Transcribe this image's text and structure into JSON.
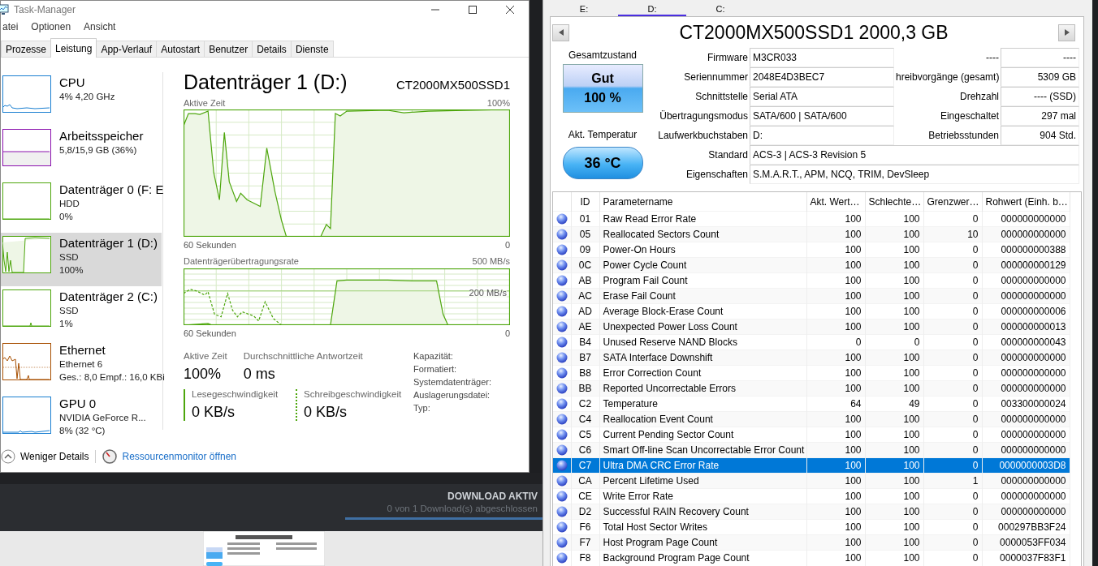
{
  "task_manager": {
    "title": "Task-Manager",
    "menu": [
      "atei",
      "Optionen",
      "Ansicht"
    ],
    "tabs": [
      {
        "label": "Prozesse",
        "selected": false
      },
      {
        "label": "Leistung",
        "selected": true
      },
      {
        "label": "App-Verlauf",
        "selected": false
      },
      {
        "label": "Autostart",
        "selected": false
      },
      {
        "label": "Benutzer",
        "selected": false
      },
      {
        "label": "Details",
        "selected": false
      },
      {
        "label": "Dienste",
        "selected": false
      }
    ],
    "devices": [
      {
        "kind": "cpu",
        "name": "CPU",
        "lines": [
          "4%  4,20 GHz"
        ],
        "selected": false
      },
      {
        "kind": "memory",
        "name": "Arbeitsspeicher",
        "lines": [
          "5,8/15,9 GB (36%)"
        ],
        "selected": false
      },
      {
        "kind": "disk",
        "name": "Datenträger 0 (F: E",
        "lines": [
          "HDD",
          "0%"
        ],
        "selected": false
      },
      {
        "kind": "disk",
        "name": "Datenträger 1 (D:)",
        "lines": [
          "SSD",
          "100%"
        ],
        "selected": true
      },
      {
        "kind": "disk",
        "name": "Datenträger 2 (C:)",
        "lines": [
          "SSD",
          "1%"
        ],
        "selected": false
      },
      {
        "kind": "ethernet",
        "name": "Ethernet",
        "lines": [
          "Ethernet 6",
          "Ges.: 8,0  Empf.: 16,0 KBi"
        ],
        "selected": false
      },
      {
        "kind": "gpu",
        "name": "GPU 0",
        "lines": [
          "NVIDIA GeForce R...",
          "8%  (32 °C)"
        ],
        "selected": false
      }
    ],
    "detail": {
      "title": "Datenträger 1 (D:)",
      "model": "CT2000MX500SSD1",
      "graphs": [
        {
          "kind": "active",
          "label": "Aktive Zeit",
          "max": "100%",
          "time": "60 Sekunden",
          "min": "0"
        },
        {
          "kind": "transfer",
          "label": "Datenträgerübertragungsrate",
          "max": "500 MB/s",
          "marker": "200 MB/s",
          "time": "60 Sekunden",
          "min": "0"
        }
      ],
      "stats": [
        {
          "label": "Aktive Zeit",
          "value": "100%"
        },
        {
          "label": "Durchschnittliche Antwortzeit",
          "value": "0 ms"
        }
      ],
      "speeds": [
        {
          "kind": "read",
          "label": "Lesegeschwindigkeit",
          "value": "0 KB/s"
        },
        {
          "kind": "write",
          "label": "Schreibgeschwindigkeit",
          "value": "0 KB/s"
        }
      ],
      "properties": [
        "Kapazität:",
        "Formatiert:",
        "Systemdatenträger:",
        "Auslagerungsdatei:",
        "Typ:"
      ]
    },
    "footer": {
      "toggle": "Weniger Details",
      "link": "Ressourcenmonitor öffnen"
    }
  },
  "download": {
    "title": "DOWNLOAD AKTIV",
    "status": "0 von 1 Download(s) abgeschlossen",
    "level": 1
  },
  "disk_info": {
    "drives": [
      {
        "label": "E:",
        "selected": false
      },
      {
        "label": "D:",
        "selected": true
      },
      {
        "label": "C:",
        "selected": false
      }
    ],
    "title": "CT2000MX500SSD1 2000,3 GB",
    "health": {
      "label": "Gesamtzustand",
      "status": "Gut",
      "percent": "100 %"
    },
    "temperature": {
      "label": "Akt. Temperatur",
      "value": "36 °C"
    },
    "fields": [
      {
        "label": "Firmware",
        "value": "M3CR033",
        "right_label": "----",
        "right_value": "----"
      },
      {
        "label": "Seriennummer",
        "value": "2048E4D3BEC7",
        "right_label": "hreibvorgänge (gesamt)",
        "right_value": "5309 GB"
      },
      {
        "label": "Schnittstelle",
        "value": "Serial ATA",
        "right_label": "Drehzahl",
        "right_value": "---- (SSD)"
      },
      {
        "label": "Übertragungsmodus",
        "value": "SATA/600 | SATA/600",
        "right_label": "Eingeschaltet",
        "right_value": "297 mal"
      },
      {
        "label": "Laufwerkbuchstaben",
        "value": "D:",
        "right_label": "Betriebsstunden",
        "right_value": "904 Std."
      }
    ],
    "wide_fields": [
      {
        "label": "Standard",
        "value": "ACS-3 | ACS-3 Revision 5"
      },
      {
        "label": "Eigenschaften",
        "value": "S.M.A.R.T., APM, NCQ, TRIM, DevSleep"
      }
    ],
    "columns": [
      "ID",
      "Parametername",
      "Akt. Wert…",
      "Schlechte…",
      "Grenzwer…",
      "Rohwert (Einh. b…"
    ],
    "rows": [
      {
        "id": "01",
        "name": "Raw Read Error Rate",
        "current": "100",
        "worst": "100",
        "threshold": "0",
        "raw": "000000000000",
        "selected": false
      },
      {
        "id": "05",
        "name": "Reallocated Sectors Count",
        "current": "100",
        "worst": "100",
        "threshold": "10",
        "raw": "000000000000",
        "selected": false
      },
      {
        "id": "09",
        "name": "Power-On Hours",
        "current": "100",
        "worst": "100",
        "threshold": "0",
        "raw": "000000000388",
        "selected": false
      },
      {
        "id": "0C",
        "name": "Power Cycle Count",
        "current": "100",
        "worst": "100",
        "threshold": "0",
        "raw": "000000000129",
        "selected": false
      },
      {
        "id": "AB",
        "name": "Program Fail Count",
        "current": "100",
        "worst": "100",
        "threshold": "0",
        "raw": "000000000000",
        "selected": false
      },
      {
        "id": "AC",
        "name": "Erase Fail Count",
        "current": "100",
        "worst": "100",
        "threshold": "0",
        "raw": "000000000000",
        "selected": false
      },
      {
        "id": "AD",
        "name": "Average Block-Erase Count",
        "current": "100",
        "worst": "100",
        "threshold": "0",
        "raw": "000000000006",
        "selected": false
      },
      {
        "id": "AE",
        "name": "Unexpected Power Loss Count",
        "current": "100",
        "worst": "100",
        "threshold": "0",
        "raw": "000000000013",
        "selected": false
      },
      {
        "id": "B4",
        "name": "Unused Reserve NAND Blocks",
        "current": "0",
        "worst": "0",
        "threshold": "0",
        "raw": "000000000043",
        "selected": false
      },
      {
        "id": "B7",
        "name": "SATA Interface Downshift",
        "current": "100",
        "worst": "100",
        "threshold": "0",
        "raw": "000000000000",
        "selected": false
      },
      {
        "id": "B8",
        "name": "Error Correction Count",
        "current": "100",
        "worst": "100",
        "threshold": "0",
        "raw": "000000000000",
        "selected": false
      },
      {
        "id": "BB",
        "name": "Reported Uncorrectable Errors",
        "current": "100",
        "worst": "100",
        "threshold": "0",
        "raw": "000000000000",
        "selected": false
      },
      {
        "id": "C2",
        "name": "Temperature",
        "current": "64",
        "worst": "49",
        "threshold": "0",
        "raw": "003300000024",
        "selected": false
      },
      {
        "id": "C4",
        "name": "Reallocation Event Count",
        "current": "100",
        "worst": "100",
        "threshold": "0",
        "raw": "000000000000",
        "selected": false
      },
      {
        "id": "C5",
        "name": "Current Pending Sector Count",
        "current": "100",
        "worst": "100",
        "threshold": "0",
        "raw": "000000000000",
        "selected": false
      },
      {
        "id": "C6",
        "name": "Smart Off-line Scan Uncorrectable Error Count",
        "current": "100",
        "worst": "100",
        "threshold": "0",
        "raw": "000000000000",
        "selected": false
      },
      {
        "id": "C7",
        "name": "Ultra DMA CRC Error Rate",
        "current": "100",
        "worst": "100",
        "threshold": "0",
        "raw": "0000000003D8",
        "selected": true
      },
      {
        "id": "CA",
        "name": "Percent Lifetime Used",
        "current": "100",
        "worst": "100",
        "threshold": "1",
        "raw": "000000000000",
        "selected": false
      },
      {
        "id": "CE",
        "name": "Write Error Rate",
        "current": "100",
        "worst": "100",
        "threshold": "0",
        "raw": "000000000000",
        "selected": false
      },
      {
        "id": "D2",
        "name": "Successful RAIN Recovery Count",
        "current": "100",
        "worst": "100",
        "threshold": "0",
        "raw": "000000000000",
        "selected": false
      },
      {
        "id": "F6",
        "name": "Total Host Sector Writes",
        "current": "100",
        "worst": "100",
        "threshold": "0",
        "raw": "000297BB3F24",
        "selected": false
      },
      {
        "id": "F7",
        "name": "Host Program Page Count",
        "current": "100",
        "worst": "100",
        "threshold": "0",
        "raw": "0000053FF034",
        "selected": false
      },
      {
        "id": "F8",
        "name": "Background Program Page Count",
        "current": "100",
        "worst": "100",
        "threshold": "0",
        "raw": "0000037F83F1",
        "selected": false
      }
    ]
  }
}
